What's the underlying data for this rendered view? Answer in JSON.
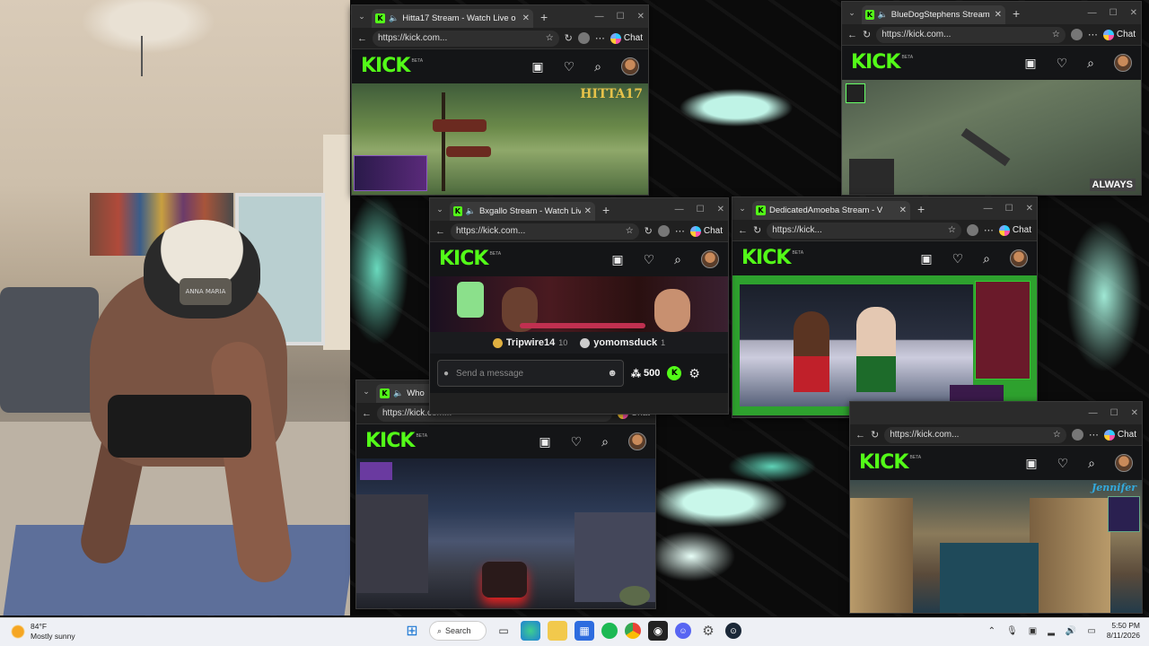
{
  "kick": {
    "logo": "KICK",
    "beta": "BETA"
  },
  "windows": [
    {
      "tab_title": "Hitta17 Stream - Watch Live o",
      "url": "https://kick.com...",
      "chat_label": "Chat",
      "overlay": "HITTA17"
    },
    {
      "tab_title": "BlueDogStephens Stream - W",
      "url": "https://kick.com...",
      "chat_label": "Chat",
      "overlay": "ALWAYS"
    },
    {
      "tab_title": "Bxgallo Stream - Watch Live o",
      "url": "https://kick.com...",
      "chat_label": "Chat"
    },
    {
      "tab_title": "DedicatedAmoeba Stream - V",
      "url": "https://kick...",
      "chat_label": "Chat"
    },
    {
      "tab_title": "Who",
      "url": "https://kick.com...",
      "chat_label": "Chat"
    },
    {
      "tab_title": "",
      "url": "https://kick.com...",
      "chat_label": "Chat",
      "overlay": "Jennifer"
    }
  ],
  "bxgallo": {
    "leader1_name": "Tripwire14",
    "leader1_count": "10",
    "leader2_name": "yomomsduck",
    "leader2_count": "1",
    "chat_placeholder": "Send a message",
    "points": "500"
  },
  "webcam": {
    "cap_text": "ANNA MARIA"
  },
  "taskbar": {
    "weather_temp": "84°F",
    "weather_desc": "Mostly sunny",
    "search_label": "Search",
    "time": "5:50 PM",
    "date": "8/11/2026"
  },
  "icons": {
    "back": "arrow-left-icon",
    "refresh": "refresh-icon",
    "star": "star-icon",
    "heart": "heart-icon",
    "search": "search-icon",
    "gear": "gear-icon"
  }
}
